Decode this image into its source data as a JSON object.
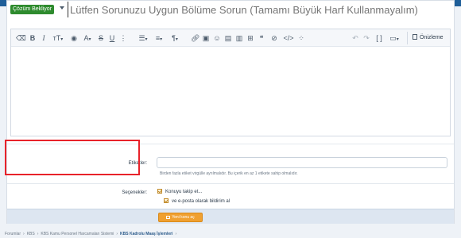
{
  "title_row": {
    "prefix": "Çözüm Bekliyor",
    "title_placeholder": "Lütfen Sorunuzu Uygun Bölüme Sorun (Tamamı Büyük Harf Kullanmayalım)"
  },
  "toolbar": {
    "icons": [
      "eraser-icon",
      "bold-icon",
      "italic-icon",
      "text-size-icon",
      "palette-icon",
      "font-icon",
      "strikethrough-icon",
      "underline-icon",
      "list-icon",
      "align-icon",
      "paragraph-icon",
      "link-icon",
      "image-icon",
      "smilie-icon",
      "media-icon",
      "table-icon",
      "quote-icon",
      "spoiler-icon",
      "code-icon",
      "more-icon",
      "undo-icon",
      "redo-icon",
      "bbcode-icon",
      "drafts-icon"
    ],
    "preview_label": "Önizleme"
  },
  "tags": {
    "label": "Etiketler:",
    "hint": "Birden fazla etiket virgülle ayrılmalıdır. Bu içerik en az 1 etikete sahip olmalıdır."
  },
  "options": {
    "label": "Seçenekler:",
    "watch_label": "Konuyu takip et...",
    "email_label": "ve e-posta olarak bildirim al"
  },
  "submit": {
    "label": "Yeni konu aç"
  },
  "breadcrumb": {
    "items": [
      "Forumlar",
      "KBS",
      "KBS Kamu Personel Harcamaları Sistemi",
      "KBS Kadrolu Maaş İşlemleri"
    ]
  },
  "colors": {
    "brand": "#1f5f99",
    "prefix_green": "#2e8b2e",
    "submit_orange": "#f0a030",
    "highlight_red": "#e8222a"
  }
}
